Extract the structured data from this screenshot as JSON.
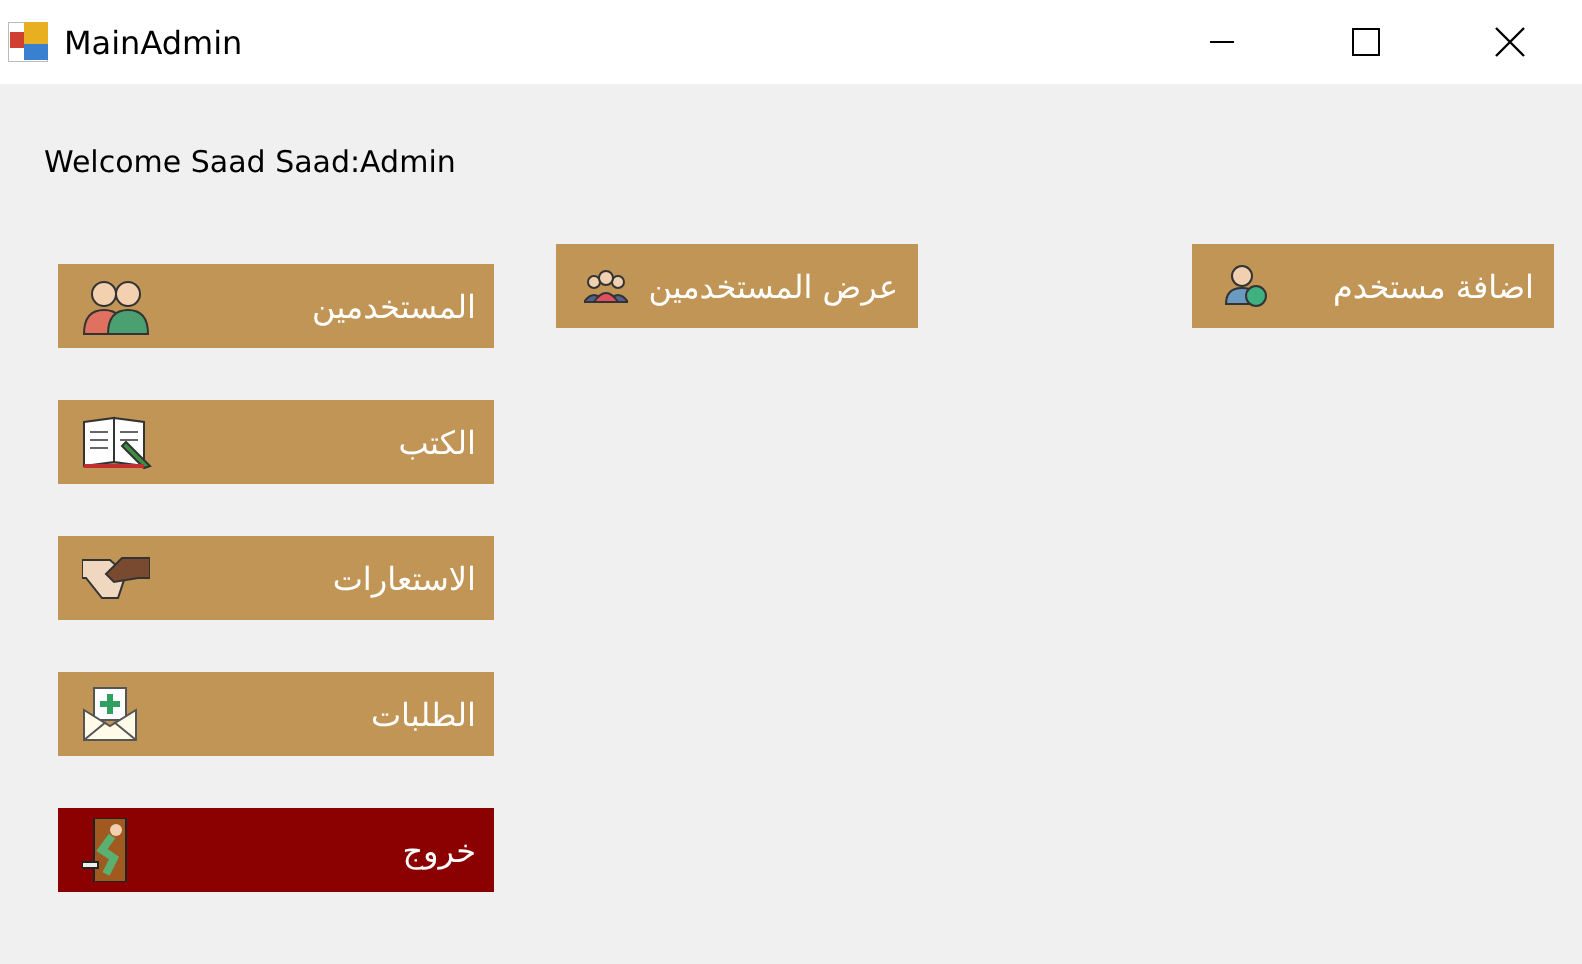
{
  "window": {
    "title": "MainAdmin"
  },
  "welcome": "Welcome Saad Saad:Admin",
  "top_buttons": [
    {
      "label": "اضافة مستخدم"
    },
    {
      "label": "عرض المستخدمين"
    }
  ],
  "menu": [
    {
      "label": "المستخدمين",
      "kind": "normal"
    },
    {
      "label": "الكتب",
      "kind": "normal"
    },
    {
      "label": "الاستعارات",
      "kind": "normal"
    },
    {
      "label": "الطلبات",
      "kind": "normal"
    },
    {
      "label": "خروج",
      "kind": "exit"
    }
  ]
}
